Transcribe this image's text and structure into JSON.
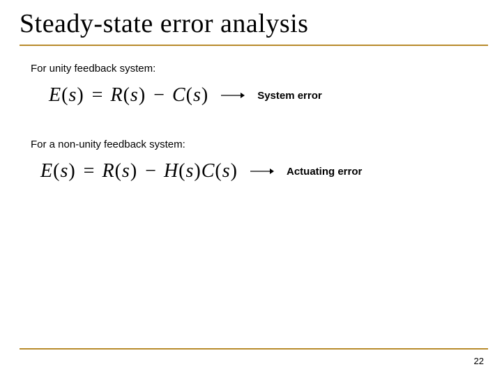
{
  "title": "Steady-state error analysis",
  "section1": {
    "label": "For unity feedback system:",
    "eq": {
      "lhs_fn": "E",
      "eq": "=",
      "rhs1_fn": "R",
      "minus": "−",
      "rhs2_fn": "C",
      "arg": "s"
    },
    "note": "System error"
  },
  "section2": {
    "label": "For a non-unity feedback system:",
    "eq": {
      "lhs_fn": "E",
      "eq": "=",
      "rhs1_fn": "R",
      "minus": "−",
      "rhs2_fn": "H",
      "rhs3_fn": "C",
      "arg": "s"
    },
    "note": "Actuating error"
  },
  "page_number": "22"
}
